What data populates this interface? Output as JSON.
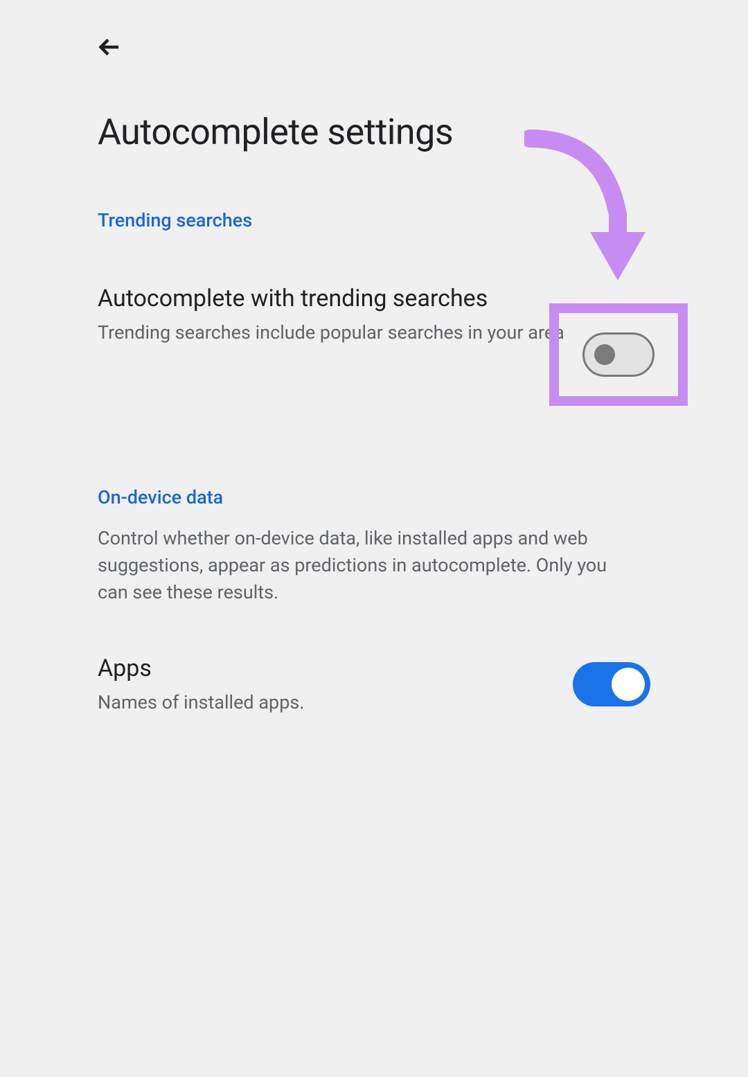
{
  "header": {
    "title": "Autocomplete settings"
  },
  "sections": {
    "trending": {
      "header": "Trending searches",
      "setting": {
        "title": "Autocomplete with trending searches",
        "subtitle": "Trending searches include popular searches in your area",
        "toggle_state": "off"
      }
    },
    "ondevice": {
      "header": "On-device data",
      "description": "Control whether on-device data, like installed apps and web suggestions, appear as predictions in autocomplete. Only you can see these results.",
      "apps": {
        "title": "Apps",
        "subtitle": "Names of installed apps.",
        "toggle_state": "on"
      }
    }
  },
  "annotation": {
    "highlight_color": "#c78cf2"
  }
}
